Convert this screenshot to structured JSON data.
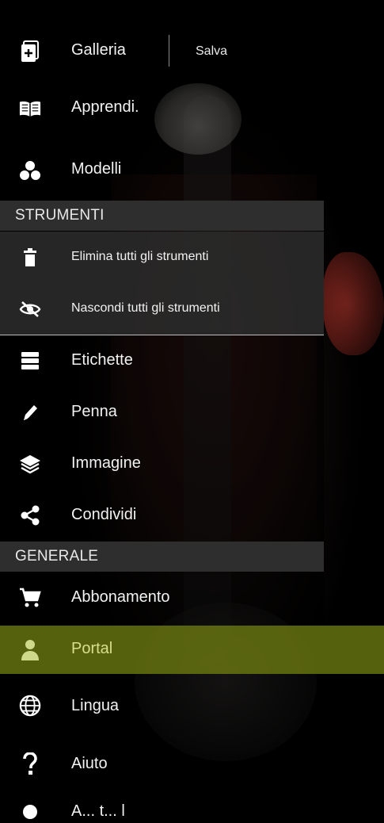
{
  "header": {
    "galleria_label": "Galleria",
    "salva_label": "Salva"
  },
  "menu": {
    "apprendi_label": "Apprendi.",
    "modelli_label": "Modelli"
  },
  "strumenti": {
    "section_label": "STRUMENTI",
    "elimina_label": "Elimina tutti gli strumenti",
    "nascondi_label": "Nascondi tutti gli strumenti",
    "etichette_label": "Etichette",
    "penna_label": "Penna",
    "immagine_label": "Immagine",
    "condividi_label": "Condividi"
  },
  "generale": {
    "section_label": "GENERALE",
    "abbonamento_label": "Abbonamento",
    "portal_label": "Portal",
    "lingua_label": "Lingua",
    "aiuto_label": "Aiuto",
    "partial_label": "A... t... l"
  },
  "colors": {
    "highlight": "#6e7c12",
    "section_bg": "#2e2e2e",
    "muscle": "#a8332a"
  },
  "icons": {
    "galleria": "add-photo-icon",
    "apprendi": "book-icon",
    "modelli": "circles-icon",
    "elimina": "trash-icon",
    "nascondi": "eye-off-icon",
    "etichette": "list-icon",
    "penna": "pen-icon",
    "immagine": "layers-icon",
    "condividi": "share-icon",
    "abbonamento": "cart-icon",
    "portal": "person-icon",
    "lingua": "globe-icon",
    "aiuto": "question-icon"
  }
}
